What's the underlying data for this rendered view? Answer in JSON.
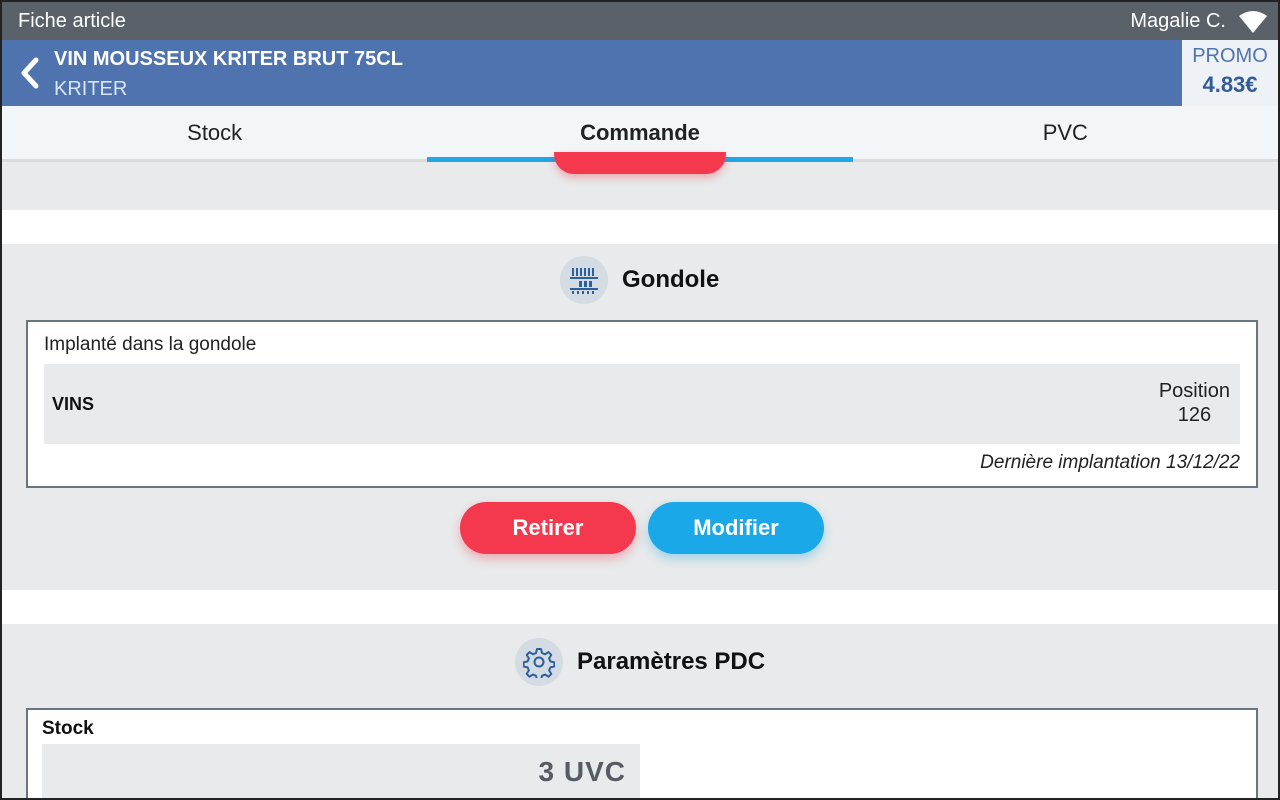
{
  "status_bar": {
    "title": "Fiche article",
    "user": "Magalie C."
  },
  "header": {
    "product_name": "VIN MOUSSEUX KRITER BRUT 75CL",
    "brand": "KRITER",
    "promo_label": "PROMO",
    "promo_price": "4.83€"
  },
  "tabs": [
    {
      "label": "Stock",
      "active": false
    },
    {
      "label": "Commande",
      "active": true
    },
    {
      "label": "PVC",
      "active": false
    }
  ],
  "gondole": {
    "title": "Gondole",
    "caption": "Implanté dans la gondole",
    "rayon": "VINS",
    "position_label": "Position",
    "position_value": "126",
    "last_implantation": "Dernière implantation 13/12/22",
    "remove_label": "Retirer",
    "modify_label": "Modifier"
  },
  "pdc": {
    "title": "Paramètres PDC",
    "stock_label": "Stock",
    "stock_value": "3  UVC"
  },
  "colors": {
    "header": "#4e73ae",
    "accent": "#21a6e6",
    "danger": "#f4394e",
    "statusbar": "#5a6168"
  }
}
